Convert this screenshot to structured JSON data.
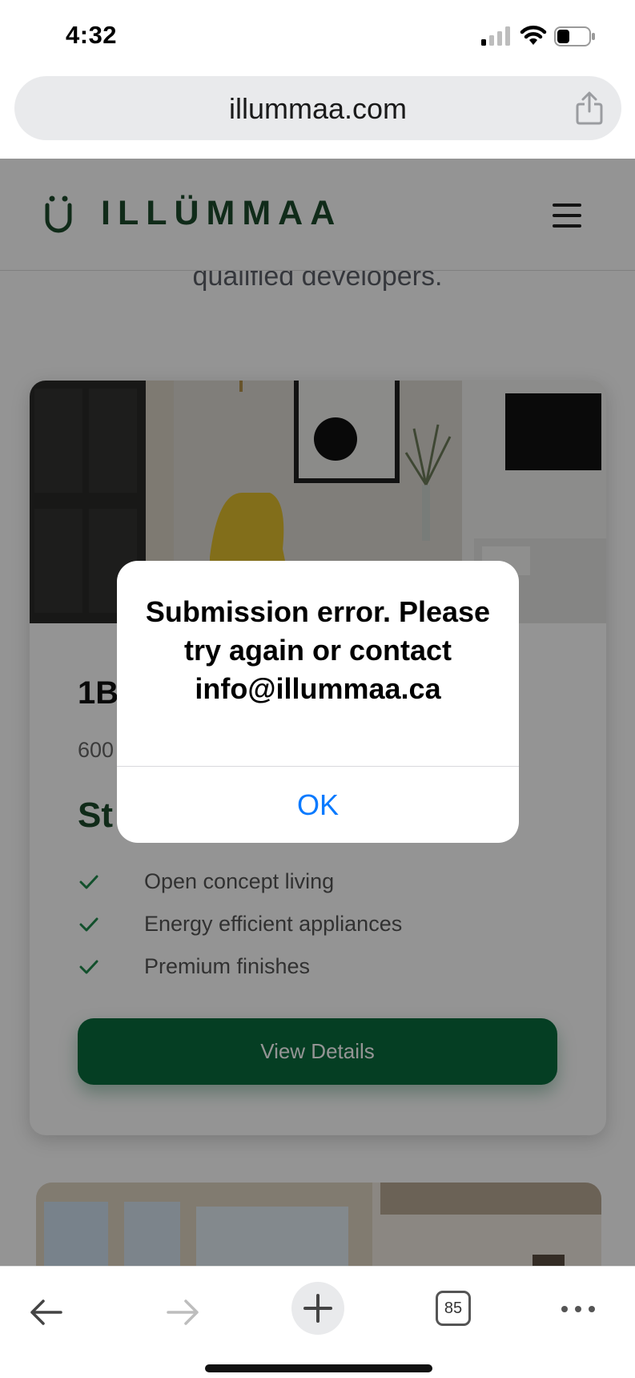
{
  "status_bar": {
    "time": "4:32",
    "icons": [
      "cellular-signal-icon",
      "wifi-icon",
      "battery-icon"
    ]
  },
  "browser": {
    "url": "illummaa.com",
    "share_icon": "share-icon"
  },
  "site": {
    "logo_text": "ILLÜMMAA",
    "menu_icon": "hamburger-menu-icon",
    "subtext": "qualified developers.",
    "brand_color": "#1d4a2b",
    "accent_color": "#0a6b3d"
  },
  "card": {
    "title": "1B",
    "subtitle": "600",
    "price_label": "St",
    "features": [
      "Open concept living",
      "Energy efficient appliances",
      "Premium finishes"
    ],
    "button_label": "View Details"
  },
  "alert": {
    "message": "Submission error. Please try again or contact info@illummaa.ca",
    "ok_label": "OK",
    "ok_color": "#0a7aff"
  },
  "toolbar": {
    "tab_count": "85",
    "icons": [
      "back-arrow-icon",
      "forward-arrow-icon",
      "new-tab-plus-icon",
      "tabs-icon",
      "more-icon"
    ]
  }
}
